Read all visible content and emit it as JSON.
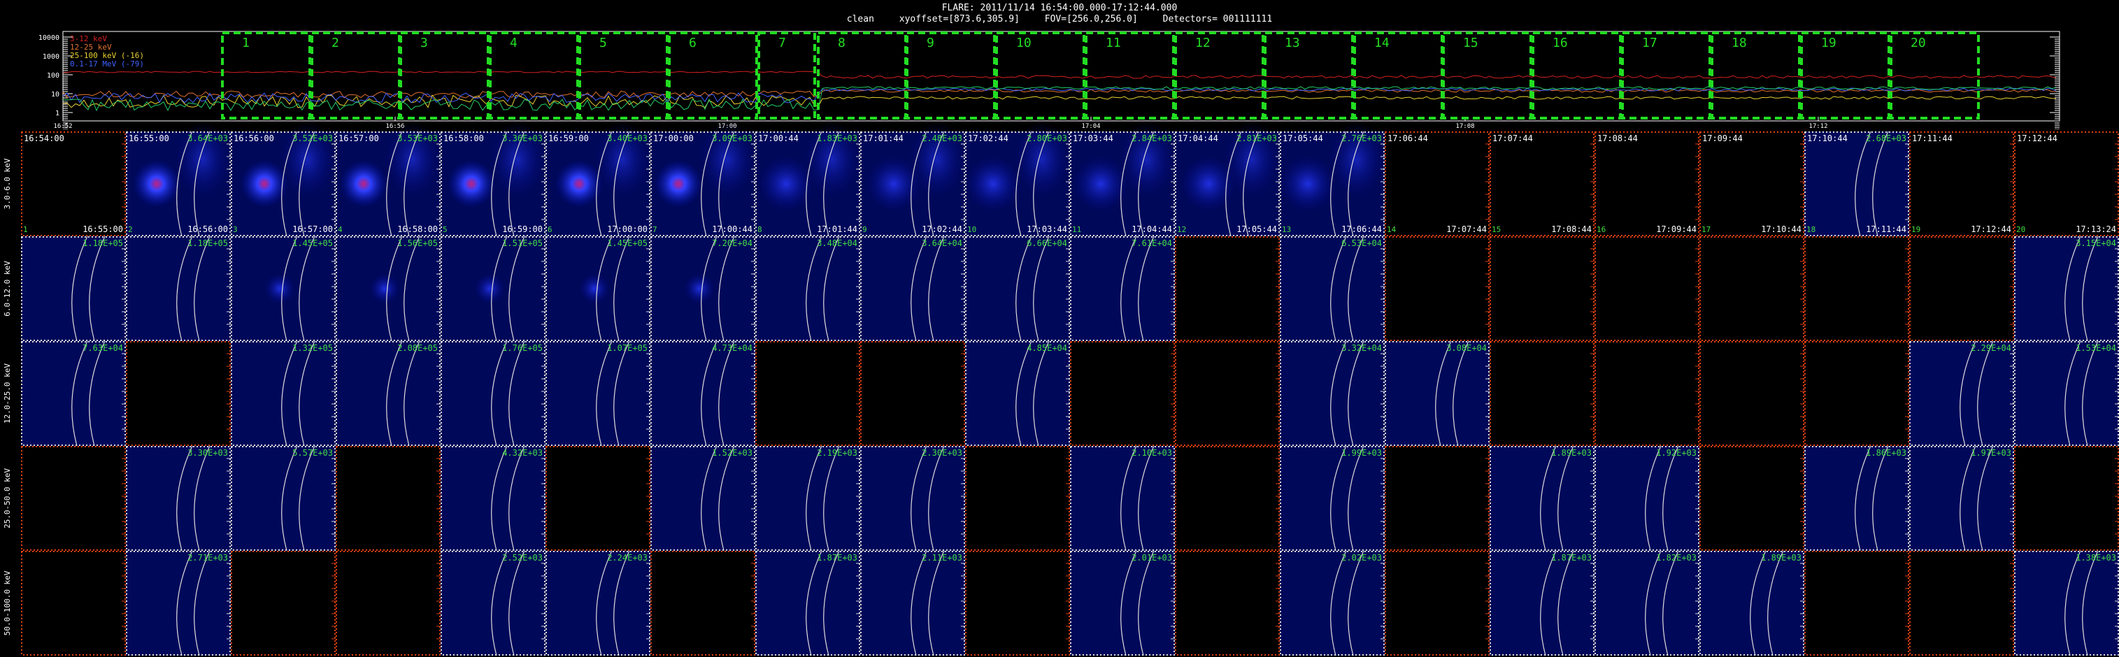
{
  "header": {
    "line1": "FLARE: 2011/11/14 16:54:00.000-17:12:44.000",
    "mode": "clean",
    "xyoffset": "xyoffset=[873.6,305.9]",
    "fov": "FOV=[256.0,256.0]",
    "detectors": "Detectors= 001111111"
  },
  "lightcurve": {
    "legend": [
      {
        "label": "3-12 keV",
        "color": "#d42020"
      },
      {
        "label": "12-25 keV",
        "color": "#e07030"
      },
      {
        "label": "25-100 keV (-16)",
        "color": "#e8d030"
      },
      {
        "label": "0.1-17 MeV (-79)",
        "color": "#4060ff"
      }
    ],
    "yticks": [
      "10000",
      "1000",
      "100",
      "10",
      "1"
    ],
    "xticks": [
      "16:52",
      "16:56",
      "17:00",
      "17:04",
      "17:08",
      "17:12"
    ],
    "intervals": [
      "1",
      "2",
      "3",
      "4",
      "5",
      "6",
      "7",
      "8",
      "9",
      "10",
      "11",
      "12",
      "13",
      "14",
      "15",
      "16",
      "17",
      "18",
      "19",
      "20"
    ]
  },
  "colors": {
    "interval_box": "#22dd22",
    "panel_border_red": "#e04010",
    "panel_border_white": "#dddddd",
    "limb": "#dddddd",
    "max_label": "#44dd44",
    "time_label": "#ffffff"
  },
  "energy_bands": [
    "3.0-6.0 keV",
    "6.0-12.0 keV",
    "12.0-25.0 keV",
    "25.0-50.0 keV",
    "50.0-100.0 keV"
  ],
  "start_times": [
    "16:54:00",
    "16:55:00",
    "16:56:00",
    "16:57:00",
    "16:58:00",
    "16:59:00",
    "17:00:00",
    "17:00:44",
    "17:01:44",
    "17:02:44",
    "17:03:44",
    "17:04:44",
    "17:05:44",
    "17:06:44",
    "17:07:44",
    "17:08:44",
    "17:09:44",
    "17:10:44",
    "17:11:44",
    "17:12:44"
  ],
  "end_times": [
    "16:55:00",
    "16:56:00",
    "16:57:00",
    "16:58:00",
    "16:59:00",
    "17:00:00",
    "17:00:44",
    "17:01:44",
    "17:02:44",
    "17:03:44",
    "17:04:44",
    "17:05:44",
    "17:06:44",
    "17:07:44",
    "17:08:44",
    "17:09:44",
    "17:10:44",
    "17:11:44",
    "17:12:44",
    "17:13:24"
  ],
  "row1_index": [
    "1",
    "2",
    "3",
    "4",
    "5",
    "6",
    "7",
    "8",
    "9",
    "10",
    "11",
    "12",
    "13",
    "14",
    "15",
    "16",
    "17",
    "18",
    "19",
    "20"
  ],
  "max_labels": [
    [
      "",
      "3.64E+03",
      "3.52E+03",
      "3.53E+03",
      "3.36E+03",
      "3.40E+03",
      "3.09E+03",
      "1.83E+03",
      "2.48E+03",
      "2.80E+03",
      "2.84E+03",
      "2.81E+03",
      "2.76E+03",
      "",
      "",
      "",
      "",
      "2.68E+03",
      "",
      ""
    ],
    [
      "1.18E+05",
      "1.18E+05",
      "1.45E+05",
      "1.56E+05",
      "1.51E+05",
      "1.45E+05",
      "7.20E+04",
      "3.48E+04",
      "3.64E+04",
      "6.66E+04",
      "7.61E+04",
      "",
      "6.53E+04",
      "",
      "",
      "",
      "",
      "",
      "",
      "3.15E+04"
    ],
    [
      "7.63E+04",
      "",
      "1.32E+05",
      "2.08E+05",
      "1.76E+05",
      "1.07E+05",
      "4.73E+04",
      "",
      "",
      "4.85E+04",
      "",
      "",
      "3.32E+04",
      "3.08E+04",
      "",
      "",
      "",
      "",
      "2.29E+04",
      "1.53E+04"
    ],
    [
      "",
      "3.30E+03",
      "5.57E+03",
      "",
      "4.32E+03",
      "",
      "1.52E+03",
      "2.19E+03",
      "2.30E+03",
      "",
      "2.10E+03",
      "",
      "1.99E+03",
      "",
      "1.89E+03",
      "1.92E+03",
      "",
      "1.86E+03",
      "1.97E+03",
      ""
    ],
    [
      "",
      "2.71E+03",
      "",
      "",
      "2.52E+03",
      "2.24E+03",
      "",
      "1.87E+03",
      "2.11E+03",
      "",
      "2.01E+03",
      "",
      "2.02E+03",
      "",
      "1.87E+03",
      "1.82E+03",
      "1.89E+03",
      "",
      "",
      "1.38E+03"
    ]
  ],
  "panel_images": [
    [
      0,
      1,
      1,
      1,
      1,
      1,
      1,
      1,
      1,
      1,
      1,
      1,
      1,
      0,
      0,
      0,
      0,
      1,
      0,
      0
    ],
    [
      1,
      1,
      1,
      1,
      1,
      1,
      1,
      1,
      1,
      1,
      1,
      0,
      1,
      0,
      0,
      0,
      0,
      0,
      0,
      1
    ],
    [
      1,
      0,
      1,
      1,
      1,
      1,
      1,
      0,
      0,
      1,
      0,
      0,
      1,
      1,
      0,
      0,
      0,
      0,
      1,
      1
    ],
    [
      0,
      1,
      1,
      0,
      1,
      0,
      1,
      1,
      1,
      0,
      1,
      0,
      1,
      0,
      1,
      1,
      0,
      1,
      1,
      0
    ],
    [
      0,
      1,
      0,
      0,
      1,
      1,
      0,
      1,
      1,
      0,
      1,
      0,
      1,
      0,
      1,
      1,
      1,
      0,
      0,
      1
    ]
  ]
}
